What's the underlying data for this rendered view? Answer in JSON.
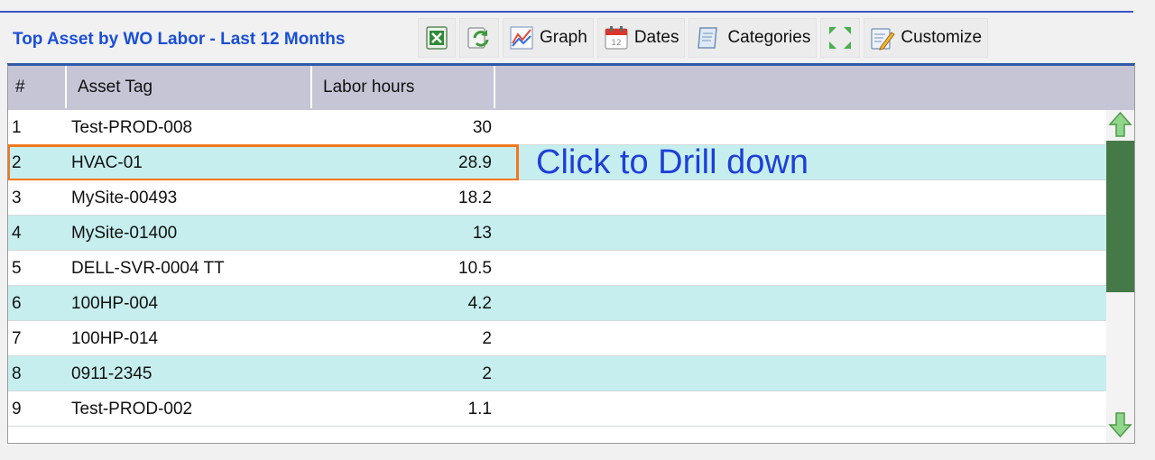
{
  "panel": {
    "title": "Top Asset by WO Labor - Last 12 Months",
    "overlay_label": "Click to Drill down"
  },
  "toolbar": {
    "graph_label": "Graph",
    "dates_label": "Dates",
    "categories_label": "Categories",
    "customize_label": "Customize"
  },
  "table": {
    "columns": [
      "#",
      "Asset Tag",
      "Labor hours"
    ],
    "rows": [
      {
        "num": "1",
        "tag": "Test-PROD-008",
        "hours": "30"
      },
      {
        "num": "2",
        "tag": "HVAC-01",
        "hours": "28.9"
      },
      {
        "num": "3",
        "tag": "MySite-00493",
        "hours": "18.2"
      },
      {
        "num": "4",
        "tag": "MySite-01400",
        "hours": "13"
      },
      {
        "num": "5",
        "tag": "DELL-SVR-0004 TT",
        "hours": "10.5"
      },
      {
        "num": "6",
        "tag": "100HP-004",
        "hours": "4.2"
      },
      {
        "num": "7",
        "tag": "100HP-014",
        "hours": "2"
      },
      {
        "num": "8",
        "tag": "0911-2345",
        "hours": "2"
      },
      {
        "num": "9",
        "tag": "Test-PROD-002",
        "hours": "1.1"
      }
    ],
    "highlighted_row_index": 1
  },
  "colors": {
    "title": "#1a4fd6",
    "highlight_border": "#f0781e",
    "alt_row": "#c6eeee",
    "scroll_thumb": "#457a48",
    "overlay_text": "#1e3fd8"
  }
}
